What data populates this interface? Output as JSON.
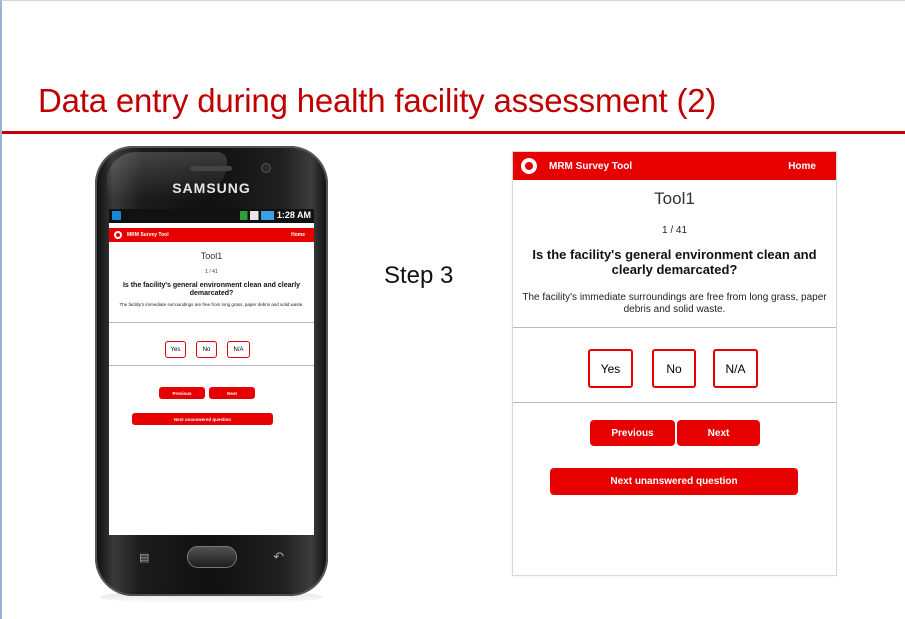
{
  "slide": {
    "title": "Data entry during health facility assessment (2)",
    "step_label": "Step 3"
  },
  "phone": {
    "brand": "SAMSUNG",
    "status_time": "1:28 AM",
    "menu_icon": "menu-icon",
    "back_icon": "back-arrow-icon"
  },
  "survey": {
    "app_name": "MRM Survey Tool",
    "home_label": "Home",
    "tool_name": "Tool1",
    "progress": "1 / 41",
    "question": "Is the facility's general environment clean and clearly demarcated?",
    "description": "The facility's immediate surroundings are free from long grass, paper debris and solid waste.",
    "options": [
      "Yes",
      "No",
      "N/A"
    ],
    "previous_label": "Previous",
    "next_label": "Next",
    "next_unanswered_label": "Next unanswered question"
  },
  "colors": {
    "brand_red": "#e60000",
    "title_red": "#c00000"
  }
}
